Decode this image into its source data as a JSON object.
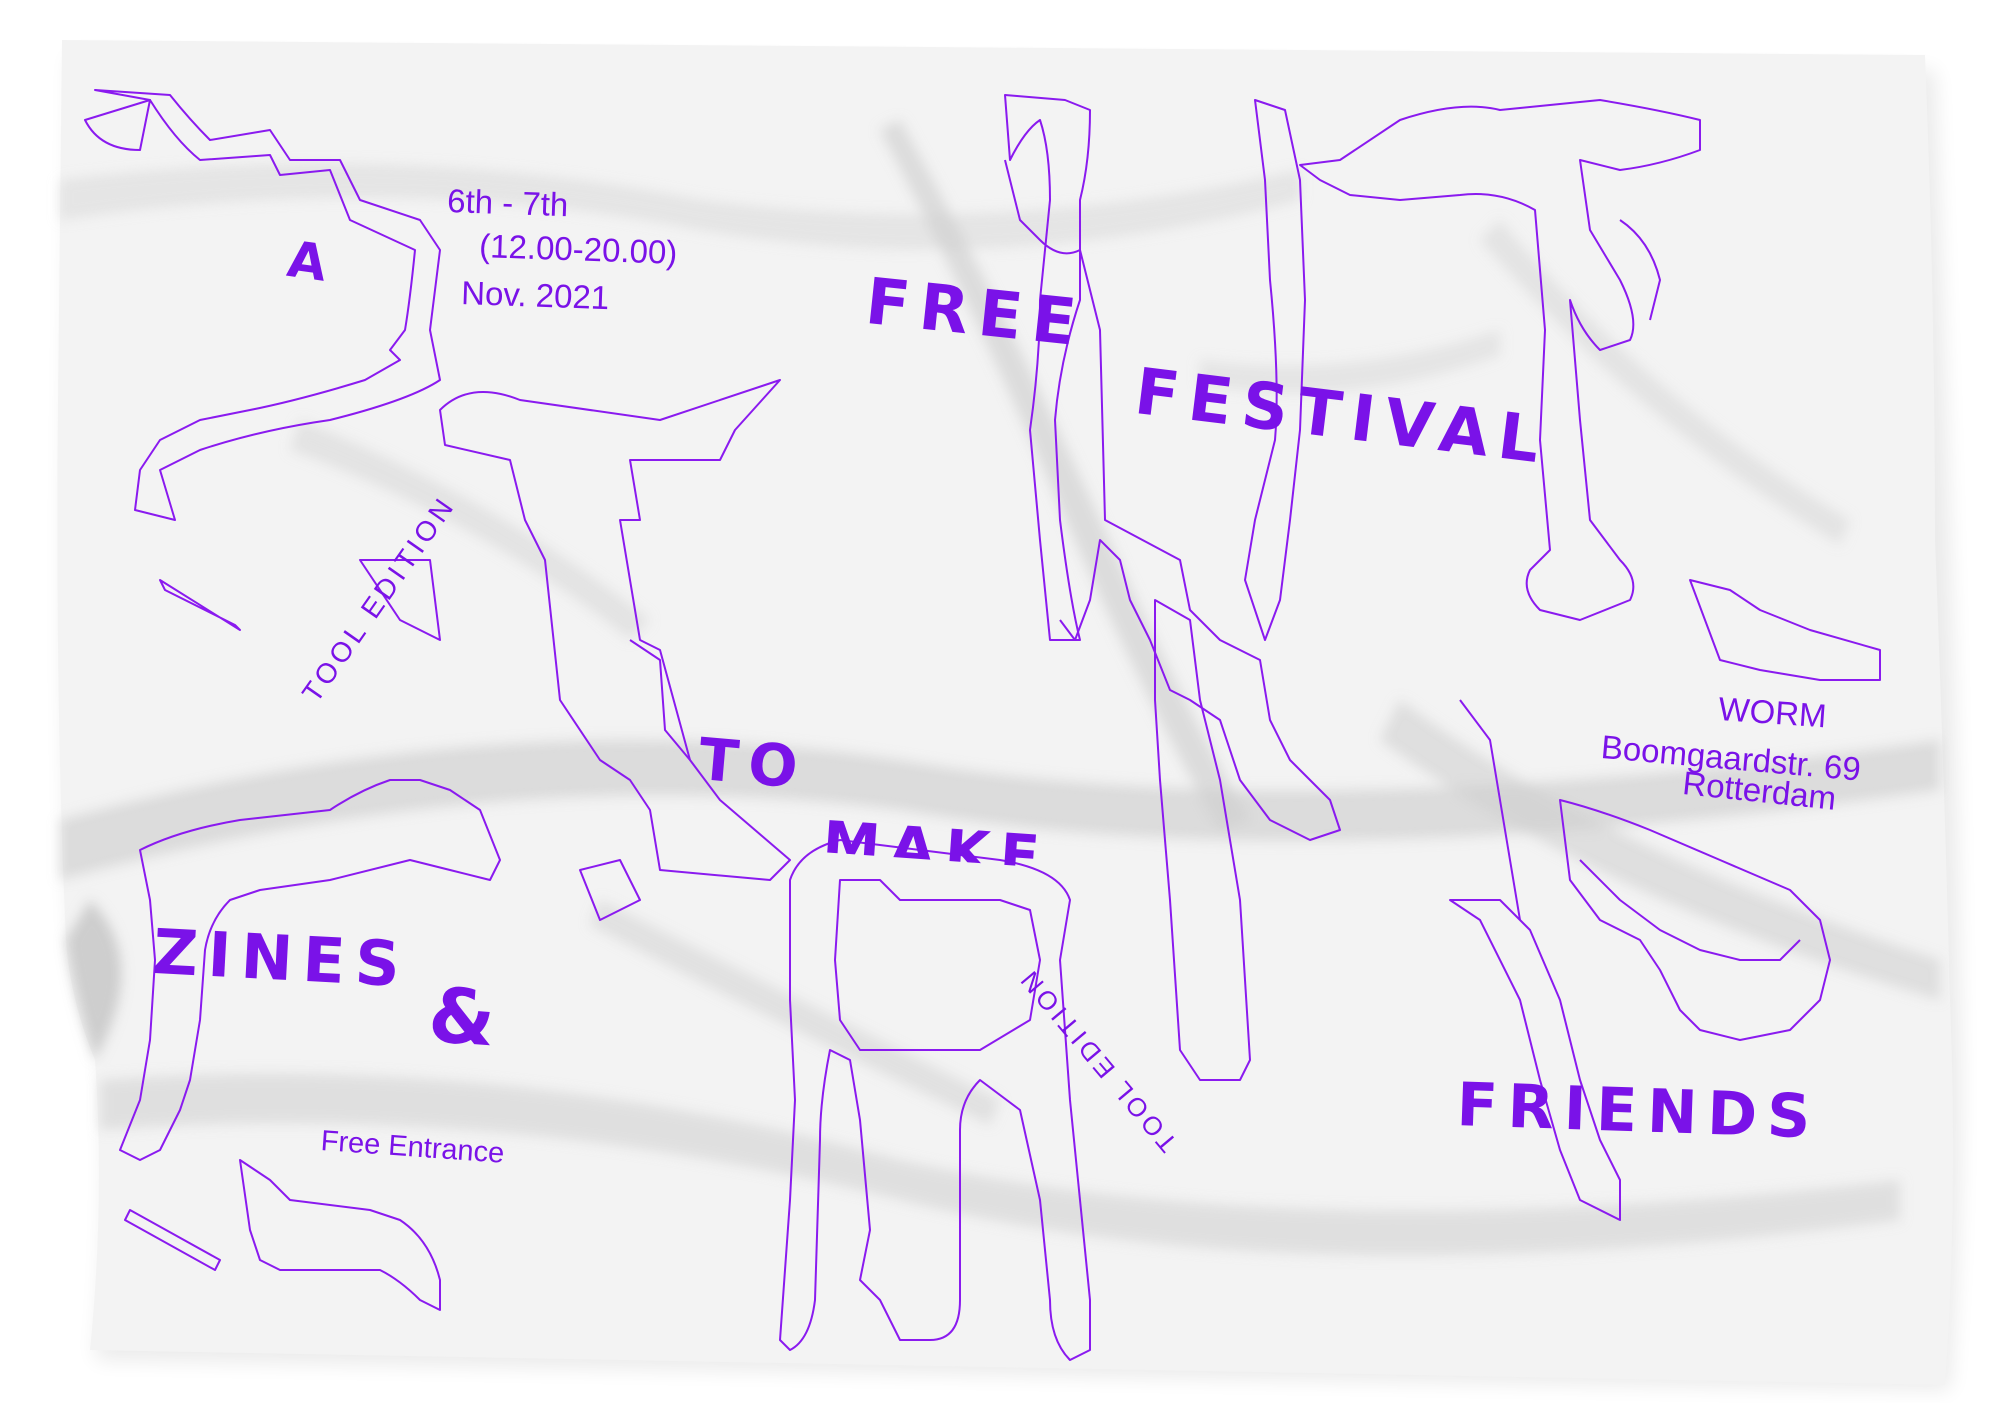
{
  "poster": {
    "accent_color": "#7a12e8",
    "cloth_color": "#f2f2f2",
    "headline": {
      "word_a": "A",
      "word_free": "FREE",
      "word_festival": "FESTIVAL",
      "word_to": "TO",
      "word_make": "MAKE",
      "word_zines": "ZINES",
      "ampersand": "&",
      "word_friends": "FRIENDS"
    },
    "dates": {
      "days": "6th - 7th",
      "hours": "(12.00-20.00)",
      "month_year": "Nov. 2021"
    },
    "venue": {
      "name": "WORM",
      "street": "Boomgaardstr. 69",
      "city": "Rotterdam"
    },
    "edition_label_left": "TOOL EDITION",
    "edition_label_right": "TOOL EDITION",
    "entrance": "Free Entrance",
    "outline_letters_description_icon": "outline-letterform-icon"
  }
}
